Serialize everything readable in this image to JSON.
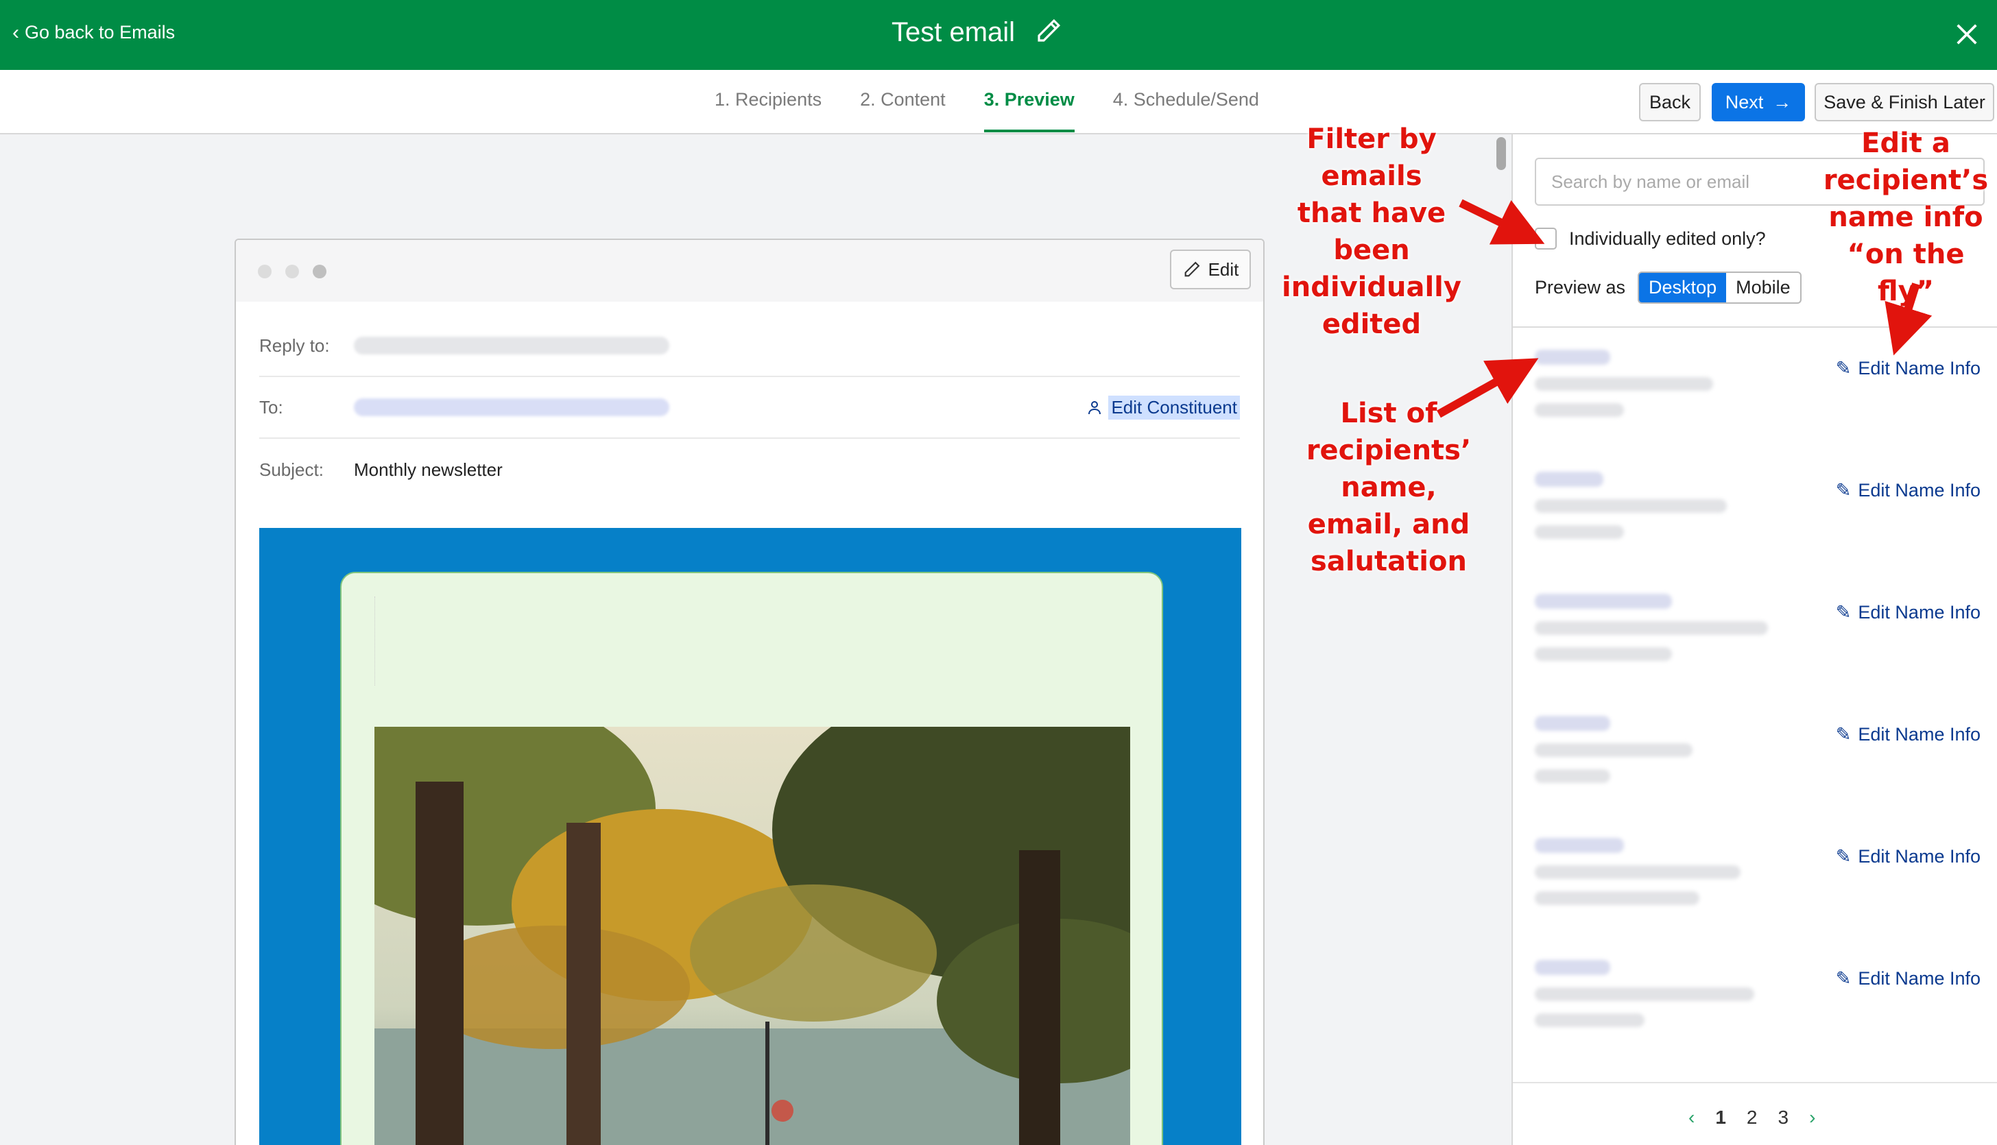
{
  "topbar": {
    "back_label": "Go back to Emails",
    "title": "Test email"
  },
  "steps": [
    "1. Recipients",
    "2. Content",
    "3. Preview",
    "4. Schedule/Send"
  ],
  "actions": {
    "back": "Back",
    "next": "Next",
    "save": "Save & Finish Later"
  },
  "card": {
    "edit_label": "Edit",
    "reply_to_label": "Reply to:",
    "to_label": "To:",
    "edit_constituent": "Edit Constituent",
    "subject_label": "Subject:",
    "subject_value": "Monthly newsletter"
  },
  "panel": {
    "search_placeholder": "Search by name or email",
    "filter_label": "Individually edited only?",
    "preview_as": "Preview as",
    "desktop": "Desktop",
    "mobile": "Mobile",
    "edit_name_label": "Edit Name Info",
    "pages": [
      "1",
      "2",
      "3"
    ]
  },
  "annotations": {
    "filter": [
      "Filter by emails",
      "that have been",
      "individually",
      "edited"
    ],
    "list": [
      "List of",
      "recipients’",
      "name,",
      "email, and",
      "salutation"
    ],
    "edit": [
      "Edit a",
      "recipient’s",
      "name info",
      "“on the fly”"
    ]
  },
  "colors": {
    "brand_green": "#008c45",
    "primary_blue": "#0b74e6",
    "annotation_red": "#e1140d",
    "email_blue": "#0680c8"
  }
}
